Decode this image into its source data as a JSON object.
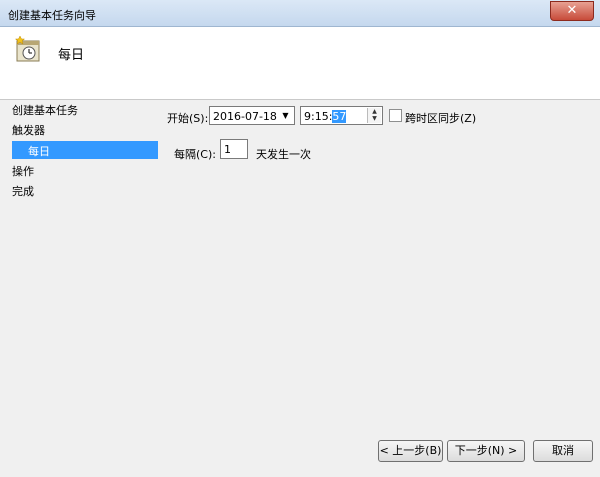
{
  "window": {
    "title": "创建基本任务向导"
  },
  "header": {
    "title": "每日",
    "icon": "task-scheduler-icon"
  },
  "nav": {
    "items": [
      {
        "label": "创建基本任务"
      },
      {
        "label": "触发器"
      },
      {
        "label": "每日"
      },
      {
        "label": "操作"
      },
      {
        "label": "完成"
      }
    ],
    "selected": "每日"
  },
  "form": {
    "start_label": "开始(S):",
    "start_date": "2016-07-18",
    "start_time_prefix": "9:15:",
    "start_time_selected": "57",
    "sync_label": "跨时区同步(Z)",
    "sync_checked": false,
    "recur_label": "每隔(C):",
    "recur_value": "1",
    "recur_suffix": "天发生一次"
  },
  "buttons": {
    "back": "< 上一步(B)",
    "next": "下一步(N) >",
    "cancel": "取消"
  }
}
